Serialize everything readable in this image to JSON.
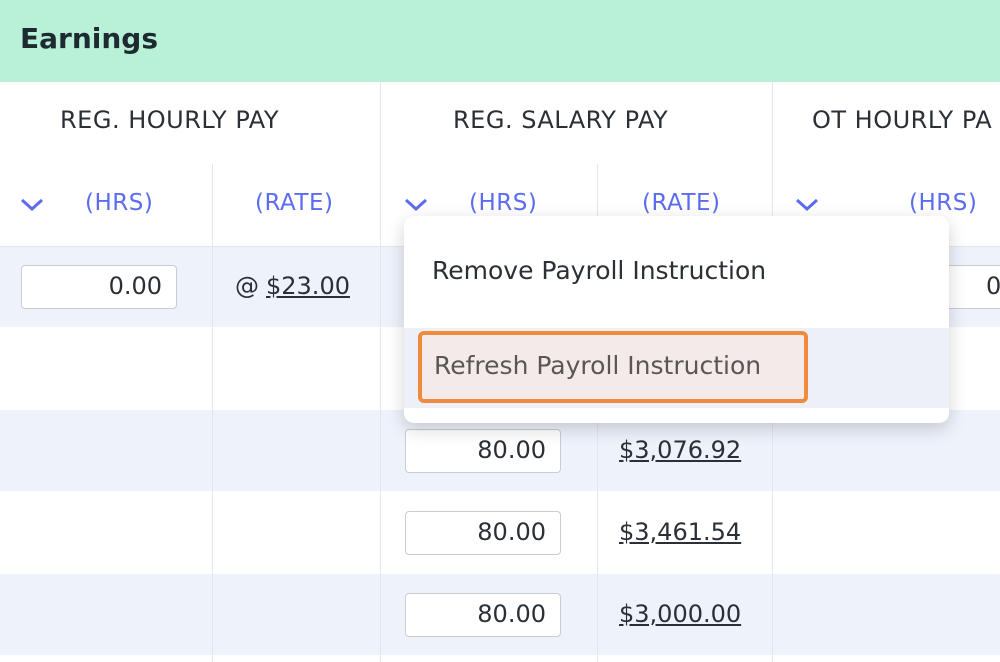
{
  "section": {
    "title": "Earnings"
  },
  "columns": {
    "groups": [
      "REG. HOURLY PAY",
      "REG. SALARY PAY",
      "OT HOURLY PA"
    ],
    "subs": [
      "(HRS)",
      "(RATE)",
      "(HRS)",
      "(RATE)",
      "(HRS)"
    ]
  },
  "rows": [
    {
      "hourly_hrs": "0.00",
      "at": "@",
      "hourly_rate": "$23.00",
      "ot_partial": "0"
    },
    {},
    {
      "salary_hrs": "80.00",
      "salary_rate": "$3,076.92"
    },
    {
      "salary_hrs": "80.00",
      "salary_rate": "$3,461.54"
    },
    {
      "salary_hrs": "80.00",
      "salary_rate": "$3,000.00"
    }
  ],
  "context_menu": {
    "items": [
      "Remove Payroll Instruction",
      "Refresh Payroll Instruction"
    ],
    "highlighted": "Refresh Payroll Instruction",
    "highlight_color": "#f08a3c"
  },
  "colors": {
    "header_bg": "#b8f0d8",
    "accent": "#5b6cf0",
    "row_alt": "#eef2fb"
  }
}
